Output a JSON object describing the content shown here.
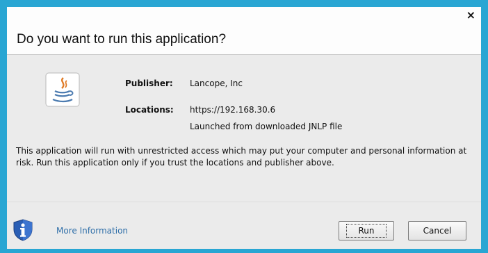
{
  "dialog": {
    "title": "Do you want to run this application?",
    "close_glyph": "×",
    "publisher_label": "Publisher:",
    "publisher_value": "Lancope, Inc",
    "locations_label": "Locations:",
    "locations_value": "https://192.168.30.6",
    "launched_note": "Launched from downloaded JNLP file",
    "message": "This application will run with unrestricted access which may put your computer and personal information at risk. Run this application only if you trust the locations and publisher above.",
    "more_info_label": "More Information",
    "run_label": "Run",
    "cancel_label": "Cancel"
  },
  "icons": {
    "app": "java-icon",
    "info": "shield-info-icon",
    "close": "close-icon"
  },
  "colors": {
    "window_border": "#29a6d3",
    "link": "#2e6ea8",
    "java_red": "#e07b26",
    "java_blue": "#4c7bb0"
  }
}
